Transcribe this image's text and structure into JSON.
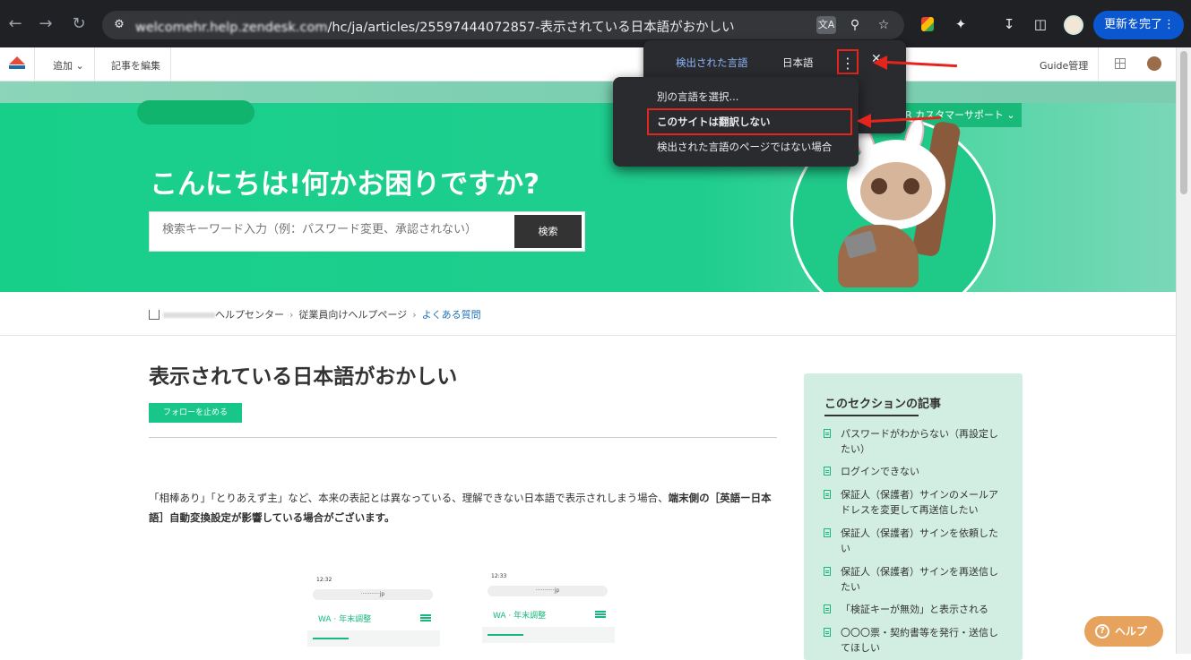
{
  "browser": {
    "back_icon": "arrow-left",
    "forward_icon": "arrow-right",
    "reload_icon": "reload",
    "url_host": "welcomehr.help.zendesk.com",
    "url_path": "/hc/ja/articles/25597444072857-表示されている日本語がおかしい",
    "update_button": "更新を完了",
    "accent": "#0b57d0"
  },
  "zendesk_bar": {
    "add_label": "追加",
    "edit_label": "記事を編集",
    "guide_admin": "Guide管理"
  },
  "hero": {
    "title": "こんにちは!何かお困りですか?",
    "search_placeholder": "検索キーワード入力（例：パスワード変更、承認されない）",
    "search_button": "検索",
    "support_button": "R カスタマーサポート",
    "brand_color": "#18cf8a"
  },
  "translate_popup": {
    "tab_detected": "検出された言語",
    "tab_japanese": "日本語",
    "menu": {
      "choose_other": "別の言語を選択...",
      "never_translate_site": "このサイトは翻訳しない",
      "not_detected_language": "検出された言語のページではない場合"
    }
  },
  "breadcrumb": {
    "help_center": "ヘルプセンター",
    "employee_help": "従業員向けヘルプページ",
    "faq": "よくある質問"
  },
  "article": {
    "title": "表示されている日本語がおかしい",
    "follow_button": "フォローを止める",
    "body_plain": "「相棒あり」「とりあえず主」など、本来の表記とは異なっている、理解できない日本語で表示されしまう場合、",
    "body_bold": "端末側の［英語ー日本語］自動変換設定が影響している場合がございます。",
    "phones": [
      {
        "time": "12:32",
        "url": "jp",
        "logo": "年末調整"
      },
      {
        "time": "12:33",
        "url": "jp",
        "logo": "年末調整"
      }
    ]
  },
  "sidebar": {
    "title": "このセクションの記事",
    "items": [
      "パスワードがわからない（再設定したい）",
      "ログインできない",
      "保証人（保護者）サインのメールアドレスを変更して再送信したい",
      "保証人（保護者）サインを依頼したい",
      "保証人（保護者）サインを再送信したい",
      "「検証キーが無効」と表示される",
      "〇〇〇票・契約書等を発行・送信してほしい"
    ]
  },
  "help_button": "ヘルプ"
}
